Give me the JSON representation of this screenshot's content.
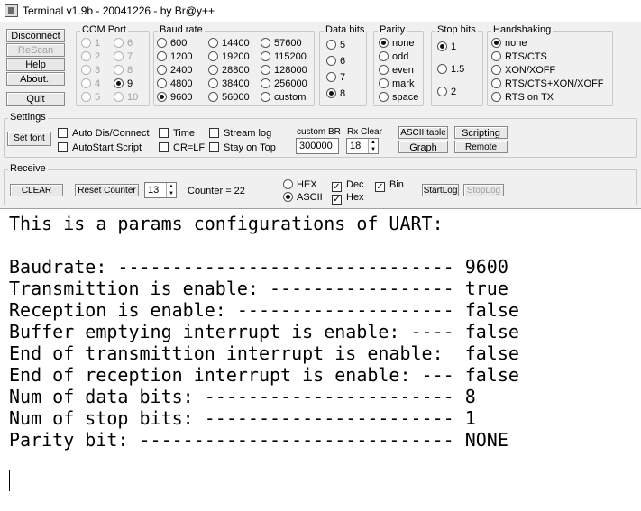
{
  "window": {
    "title": "Terminal v1.9b - 20041226 - by Br@y++"
  },
  "buttons": {
    "disconnect": "Disconnect",
    "rescan": "ReScan",
    "help": "Help",
    "about": "About..",
    "quit": "Quit",
    "set_font": "Set font",
    "ascii_table": "ASCII table",
    "scripting": "Scripting",
    "graph": "Graph",
    "remote": "Remote",
    "clear": "CLEAR",
    "reset_counter": "Reset Counter",
    "start_log": "StartLog",
    "stop_log": "StopLog"
  },
  "com_port": {
    "title": "COM Port",
    "ports": [
      "1",
      "2",
      "3",
      "4",
      "5",
      "6",
      "7",
      "8",
      "9",
      "10"
    ],
    "selected": "9"
  },
  "baud_rate": {
    "title": "Baud rate",
    "options": [
      "600",
      "1200",
      "2400",
      "4800",
      "9600",
      "14400",
      "19200",
      "28800",
      "38400",
      "56000",
      "57600",
      "115200",
      "128000",
      "256000",
      "custom"
    ],
    "selected": "9600"
  },
  "data_bits": {
    "title": "Data bits",
    "options": [
      "5",
      "6",
      "7",
      "8"
    ],
    "selected": "8"
  },
  "parity": {
    "title": "Parity",
    "options": [
      "none",
      "odd",
      "even",
      "mark",
      "space"
    ],
    "selected": "none"
  },
  "stop_bits": {
    "title": "Stop bits",
    "options": [
      "1",
      "1.5",
      "2"
    ],
    "selected": "1"
  },
  "handshaking": {
    "title": "Handshaking",
    "options": [
      "none",
      "RTS/CTS",
      "XON/XOFF",
      "RTS/CTS+XON/XOFF",
      "RTS on TX"
    ],
    "selected": "none"
  },
  "settings": {
    "title": "Settings",
    "auto_dis_connect": "Auto Dis/Connect",
    "autostart_script": "AutoStart Script",
    "time": "Time",
    "cr_lf": "CR=LF",
    "stream_log": "Stream log",
    "stay_on_top": "Stay on Top",
    "custom_br_label": "custom BR",
    "custom_br_value": "300000",
    "rx_clear_label": "Rx Clear",
    "rx_clear_value": "18"
  },
  "receive": {
    "title": "Receive",
    "spin_value": "13",
    "counter_label": "Counter = ",
    "counter_value": "22",
    "hex": "HEX",
    "ascii": "ASCII",
    "dec": "Dec",
    "hex_check": "Hex",
    "bin": "Bin",
    "mode_selected": "ASCII",
    "checks_on": [
      "Dec",
      "Hex",
      "Bin"
    ]
  },
  "terminal": {
    "lines": [
      "This is a params configurations of UART:",
      "",
      "Baudrate: ------------------------------- 9600",
      "Transmittion is enable: ----------------- true",
      "Reception is enable: -------------------- false",
      "Buffer emptying interrupt is enable: ---- false",
      "End of transmittion interrupt is enable:  false",
      "End of reception interrupt is enable: --- false",
      "Num of data bits: ----------------------- 8",
      "Num of stop bits: ----------------------- 1",
      "Parity bit: ----------------------------- NONE"
    ]
  }
}
